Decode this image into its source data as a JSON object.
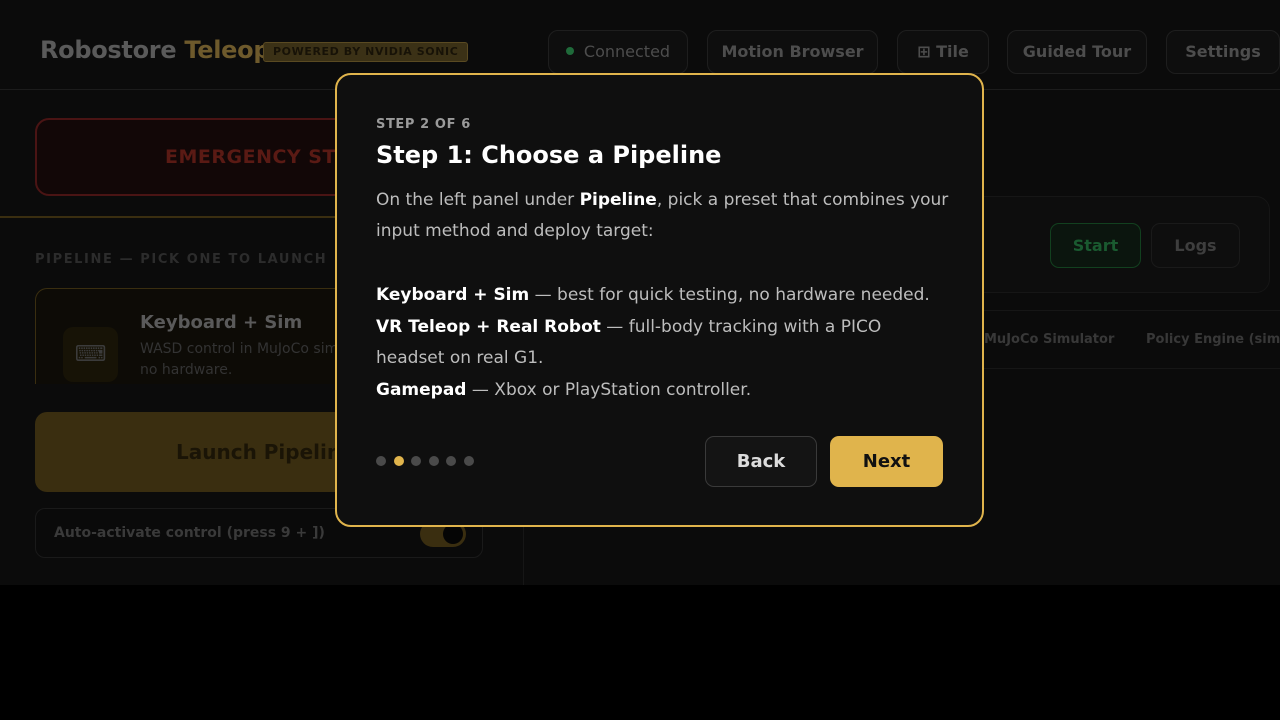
{
  "header": {
    "brand_main": "Robostore",
    "brand_accent": "Teleop",
    "powered_badge": "POWERED BY NVIDIA SONIC",
    "status": "Connected",
    "nav": {
      "motion_browser": "Motion Browser",
      "tile": "⊞ Tile",
      "guided_tour": "Guided Tour",
      "settings": "Settings"
    }
  },
  "left_panel": {
    "emergency_stop": "EMERGENCY STOP",
    "pipeline_heading": "PIPELINE — PICK ONE TO LAUNCH",
    "pipeline_card": {
      "icon": "keyboard-icon",
      "title": "Keyboard + Sim",
      "desc": "WASD control in MuJoCo sim, no hardware."
    },
    "launch_button": "Launch Pipeline",
    "auto_activate_label": "Auto-activate control (press 9 + ])",
    "auto_activate_on": true
  },
  "right_panel": {
    "start_button": "Start",
    "logs_button": "Logs",
    "tabs": [
      "MuJoCo Simulator",
      "Policy Engine (sim)"
    ]
  },
  "modal": {
    "step_label": "STEP 2 OF 6",
    "title": "Step 1: Choose a Pipeline",
    "intro_prefix": "On the left panel under ",
    "intro_bold": "Pipeline",
    "intro_suffix": ", pick a preset that combines your input method and deploy target:",
    "options": [
      {
        "name": "Keyboard + Sim",
        "desc": " — best for quick testing, no hardware needed."
      },
      {
        "name": "VR Teleop + Real Robot",
        "desc": " — full-body tracking with a PICO headset on real G1."
      },
      {
        "name": "Gamepad",
        "desc": " — Xbox or PlayStation controller."
      }
    ],
    "total_steps": 6,
    "current_step": 2,
    "back_button": "Back",
    "next_button": "Next"
  },
  "colors": {
    "accent": "#e0b44c",
    "background": "#000000",
    "modal_bg": "#0f0f0f",
    "connected": "#1f6a3a",
    "emergency": "#5a1a14"
  }
}
